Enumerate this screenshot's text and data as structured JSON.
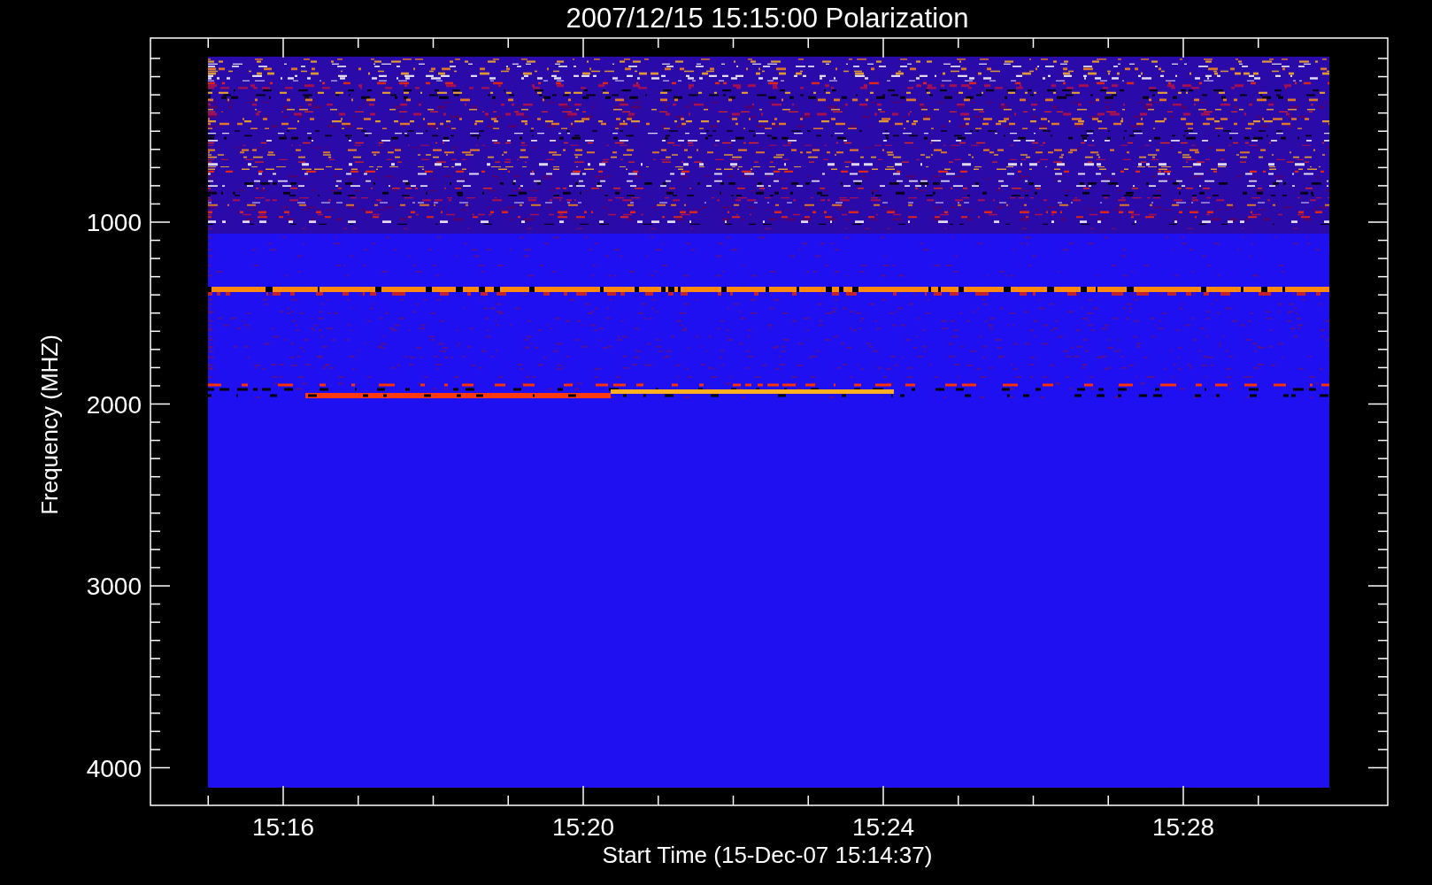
{
  "title": "2007/12/15 15:15:00 Polarization",
  "y_axis": {
    "label": "Frequency (MHZ)",
    "ticks": [
      "1000",
      "2000",
      "3000",
      "4000"
    ]
  },
  "x_axis": {
    "label": "Start Time (15-Dec-07 15:14:37)",
    "ticks": [
      "15:16",
      "15:20",
      "15:24",
      "15:28"
    ]
  }
}
